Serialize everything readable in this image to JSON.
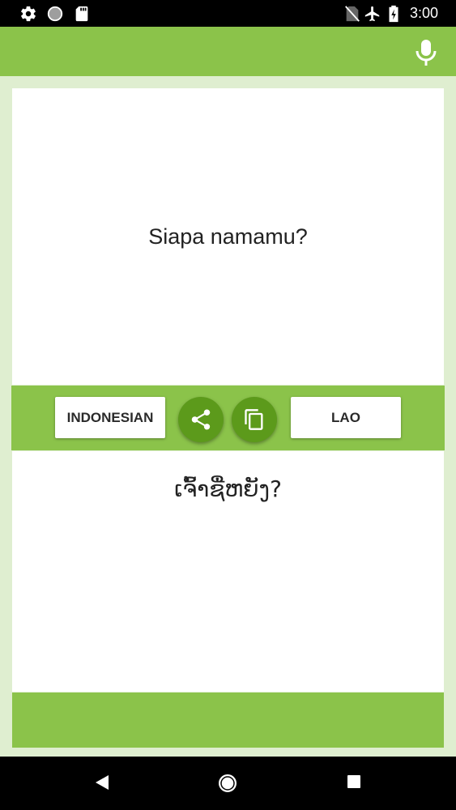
{
  "status_bar": {
    "time": "3:00",
    "left_icons": [
      "gear-icon",
      "circle-icon",
      "sd-card-icon"
    ],
    "right_icons": [
      "no-sim-icon",
      "airplane-icon",
      "battery-charging-icon"
    ]
  },
  "app_bar": {
    "mic_icon": "mic-icon",
    "color": "#8bc34a"
  },
  "source_panel": {
    "text": "Siapa namamu?"
  },
  "toolbar": {
    "source_language": "INDONESIAN",
    "target_language": "LAO",
    "share_icon": "share-icon",
    "copy_icon": "copy-icon"
  },
  "target_panel": {
    "text": "ເຈົ້າຊື່ຫຍັງ?"
  },
  "nav_bar": {
    "icons": [
      "back-icon",
      "home-icon",
      "recents-icon"
    ]
  },
  "colors": {
    "accent": "#8bc34a",
    "accent_dark": "#5c9a1b",
    "background": "#dfeed0"
  }
}
